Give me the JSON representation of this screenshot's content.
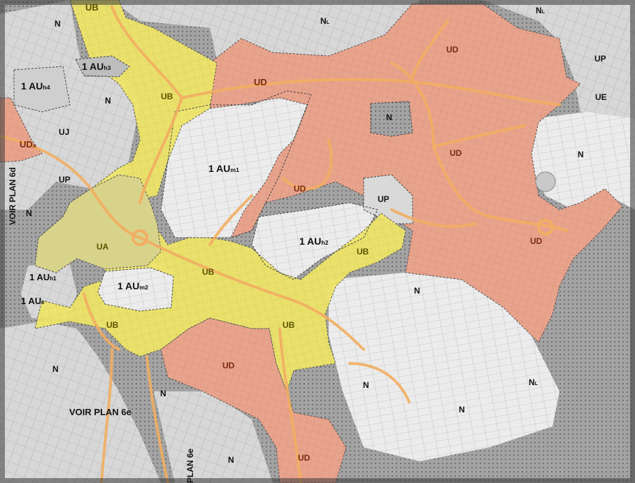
{
  "map_title": "",
  "colors": {
    "ud": "#e8a38c",
    "ub": "#f0ea6e",
    "ua": "#dcd890",
    "natural": "#9a9a9a",
    "urban_grey": "#cfcfcf",
    "road": "#f2b06a"
  },
  "zones": {
    "ub_top": "UB",
    "ub_mid": "UB",
    "ub_left": "UB",
    "ub_center": "UB",
    "ub_right": "UB",
    "ub_bottom": "UB",
    "ua": "UA",
    "ud_top": "UD",
    "ud_topleft": "UD",
    "ud_mid": "UD",
    "ud_center": "UD",
    "ud_right": "UD",
    "ud_south1": "UD",
    "ud_south2": "UD",
    "uda_main": "UD",
    "uda_sub": "a",
    "up_right": "UP",
    "up_left": "UP",
    "up_center": "UP",
    "ue": "UE",
    "uj": "UJ",
    "n_top": "N",
    "nl_top_main": "N",
    "nl_top_sub": "L",
    "nl_topright_main": "N",
    "nl_topright_sub": "L",
    "n_left": "N",
    "n_center": "N",
    "n_right": "N",
    "n_left2": "N",
    "n_mid_right": "N",
    "n_bottom_left": "N",
    "n_bottom_mid": "N",
    "n_bottom_right": "N",
    "n_bottom_far": "N",
    "nl_bottom_main": "N",
    "nl_bottom_sub": "L",
    "n_bottom_center": "N",
    "au_h3_main": "1 AU",
    "au_h3_sub": "h3",
    "au_h4_main": "1 AU",
    "au_h4_sub": "h4",
    "au_m1_main": "1 AU",
    "au_m1_sub": "m1",
    "au_h2_main": "1 AU",
    "au_h2_sub": "h2",
    "au_m2_main": "1 AU",
    "au_m2_sub": "m2",
    "au_h1_main": "1 AU",
    "au_h1_sub": "h1",
    "au_e_main": "1 AU",
    "au_e_sub": "e"
  },
  "references": {
    "plan_6d": "VOIR PLAN 6d",
    "plan_6e_bottom": "VOIR PLAN 6e",
    "plan_6e_vertical": "PLAN 6e"
  }
}
